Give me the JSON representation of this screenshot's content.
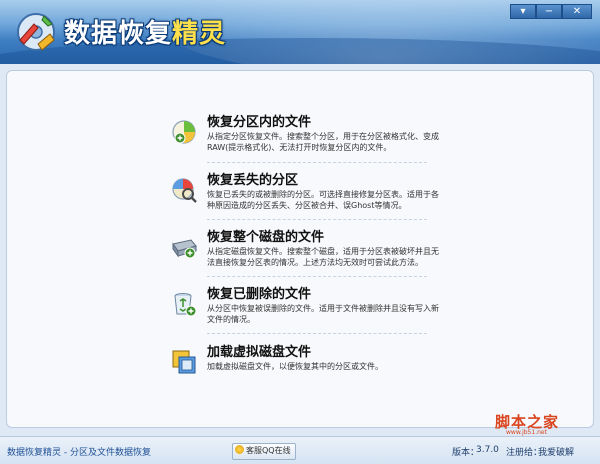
{
  "app": {
    "title_main": "数据恢复",
    "title_accent": "精灵"
  },
  "window_controls": {
    "menu": "▾",
    "minimize": "−",
    "close": "✕"
  },
  "menu": [
    {
      "title": "恢复分区内的文件",
      "desc": "从指定分区恢复文件。搜索整个分区，用于在分区被格式化、变成RAW(提示格式化)、无法打开时恢复分区内的文件。",
      "icon": "partition-recover-icon"
    },
    {
      "title": "恢复丢失的分区",
      "desc": "恢复已丢失的或被删除的分区。可选择直接修复分区表。适用于各种原因造成的分区丢失、分区被合并、误Ghost等情况。",
      "icon": "lost-partition-icon"
    },
    {
      "title": "恢复整个磁盘的文件",
      "desc": "从指定磁盘恢复文件。搜索整个磁盘，适用于分区表被破坏并且无法直接恢复分区表的情况。上述方法均无效时可尝试此方法。",
      "icon": "disk-recover-icon"
    },
    {
      "title": "恢复已删除的文件",
      "desc": "从分区中恢复被误删除的文件。适用于文件被删除并且没有写入新文件的情况。",
      "icon": "recycle-bin-icon"
    },
    {
      "title": "加载虚拟磁盘文件",
      "desc": "加载虚拟磁盘文件，以便恢复其中的分区或文件。",
      "icon": "virtual-disk-icon"
    }
  ],
  "status": {
    "left_text": "数据恢复精灵 - 分区及文件数据恢复",
    "qq_button": "客服QQ在线",
    "version_label": "版本：",
    "version_value": "3.7.0",
    "reg_label": "注册给：",
    "reg_value": "我爱破解"
  },
  "watermark": {
    "text": "脚本之家",
    "sub": "www.jb51.net"
  },
  "colors": {
    "header_dark": "#2c68ad",
    "title_accent": "#ffe04a",
    "status_text": "#1d4f96",
    "watermark": "#d9451e"
  }
}
